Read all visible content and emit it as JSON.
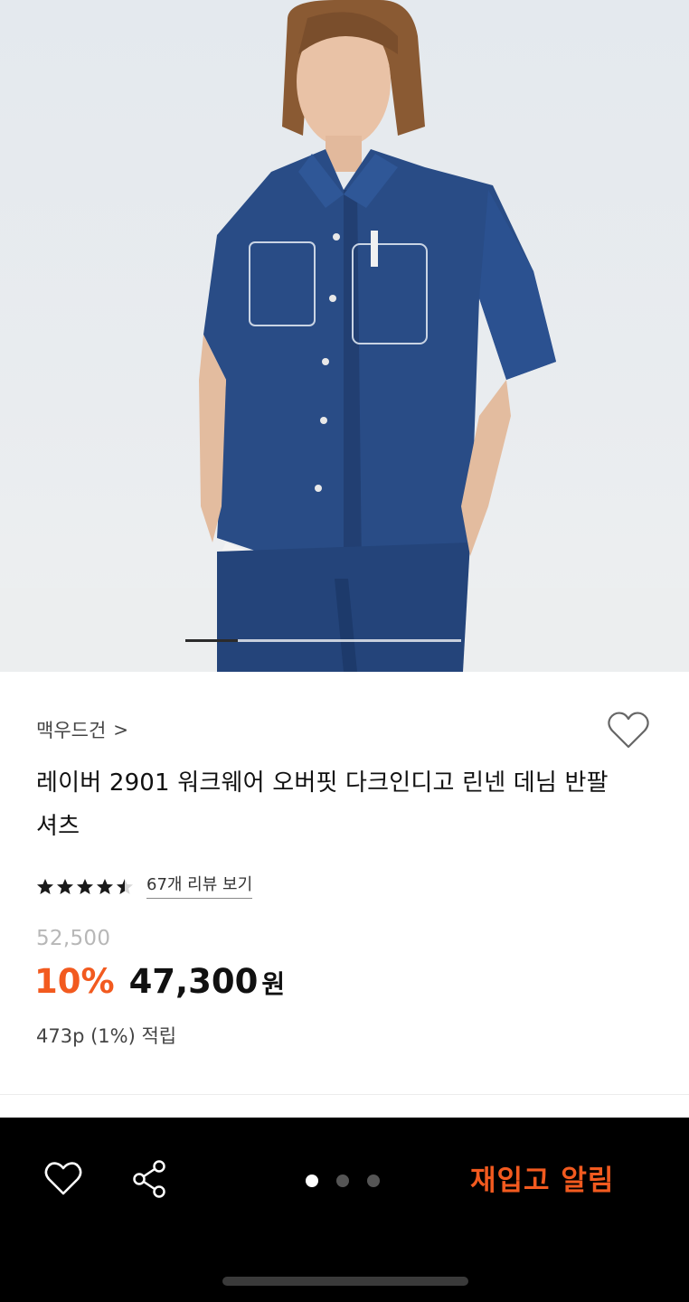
{
  "gallery": {
    "image_alt": "product-photo-denim-shirt",
    "current_index": 1,
    "progress_fraction": 0.19
  },
  "product": {
    "brand": "맥우드건",
    "brand_chevron": ">",
    "title": "레이버 2901 워크웨어 오버핏 다크인디고 린넨 데님 반팔셔츠",
    "rating": 4.5,
    "review_link": "67개 리뷰 보기",
    "original_price": "52,500",
    "discount": "10%",
    "sale_price": "47,300",
    "currency": "원",
    "points": "473p (1%) 적립"
  },
  "bottom_bar": {
    "restock_label": "재입고 알림",
    "page_dots": 3,
    "active_dot": 0
  },
  "colors": {
    "accent": "#f25a1f",
    "bar": "#000000"
  }
}
